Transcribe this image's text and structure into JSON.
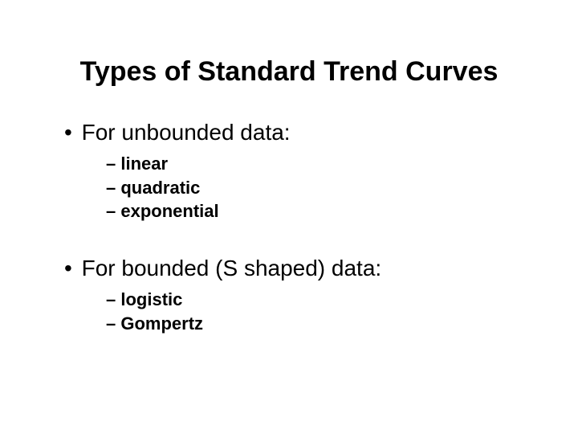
{
  "title": "Types of Standard Trend Curves",
  "sections": [
    {
      "heading": "For unbounded data:",
      "items": [
        "linear",
        "quadratic",
        "exponential"
      ]
    },
    {
      "heading": "For bounded (S shaped) data:",
      "items": [
        "logistic",
        "Gompertz"
      ]
    }
  ]
}
